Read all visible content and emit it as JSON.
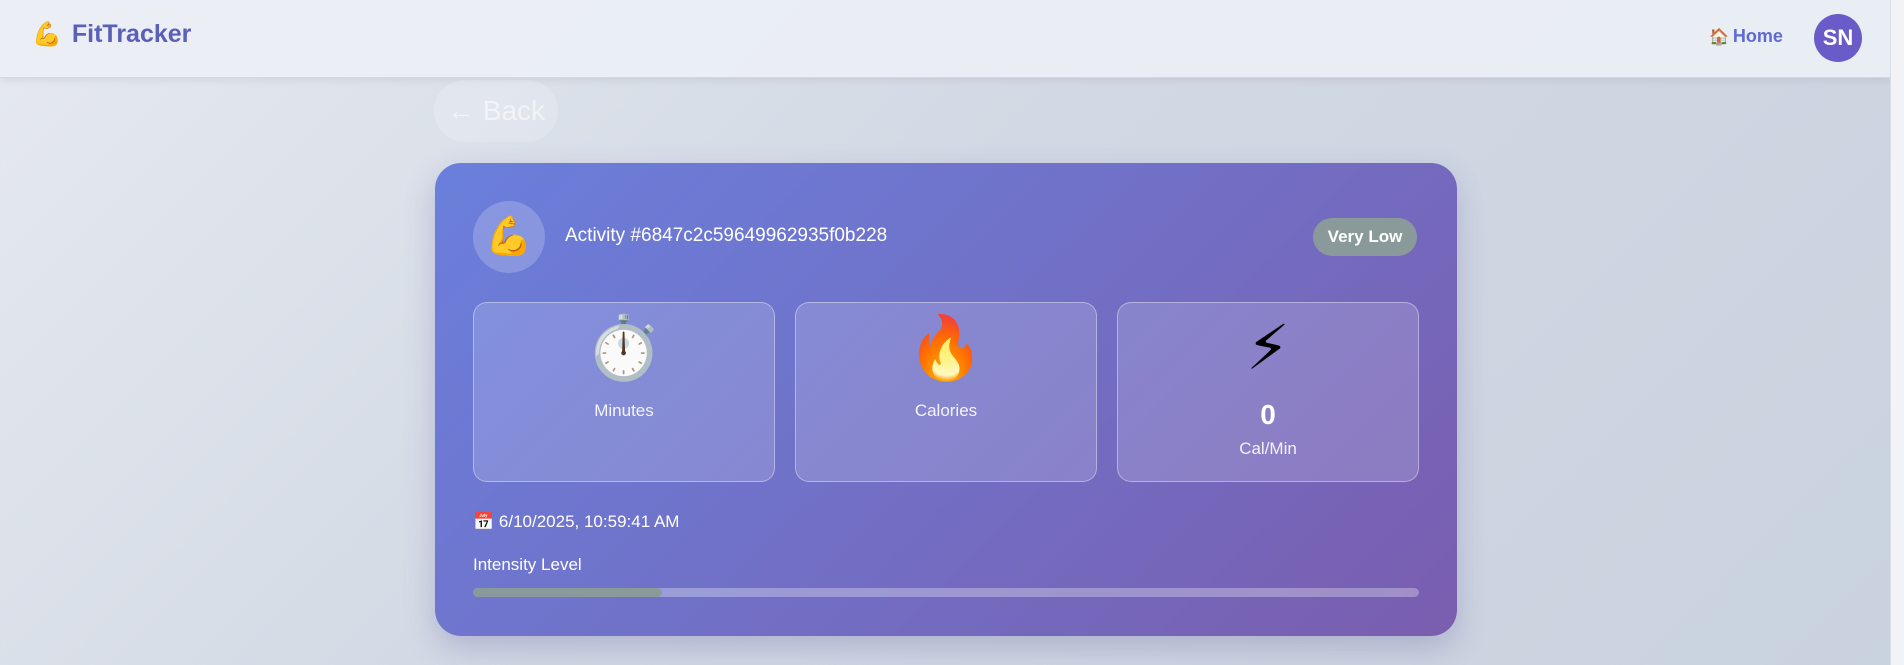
{
  "app": {
    "brand_icon": "flexed-biceps-icon",
    "brand_name": "FitTracker",
    "nav_home_icon": "house",
    "nav_home_label": "Home",
    "avatar_initials": "SN",
    "avatar_color": "#6a5cc8"
  },
  "back_label": "← Back",
  "activity": {
    "icon": "💪",
    "title": "Activity #6847c2c59649962935f0b228",
    "badge": "Very Low",
    "badge_color": "#8a9a9a",
    "stats": [
      {
        "icon": "⏱️",
        "icon_name": "stopwatch-icon",
        "value": "",
        "label": "Minutes"
      },
      {
        "icon": "🔥",
        "icon_name": "fire-icon",
        "value": "",
        "label": "Calories"
      },
      {
        "icon": "⚡",
        "icon_name": "lightning-icon",
        "value": "0",
        "label": "Cal/Min"
      }
    ],
    "date_icon": "📅",
    "date": "6/10/2025, 10:59:41 AM",
    "intensity_label": "Intensity Level",
    "intensity_fraction": 0.2
  }
}
